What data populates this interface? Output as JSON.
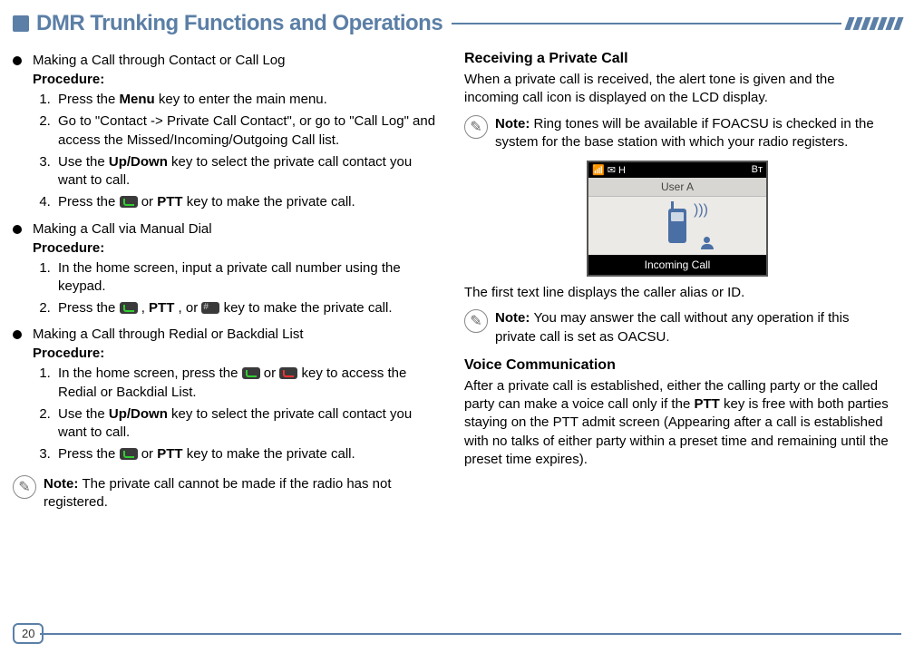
{
  "header": {
    "title": "DMR Trunking Functions and Operations"
  },
  "left": {
    "b1": {
      "title": "Making a Call through Contact or Call Log",
      "proc": "Procedure:",
      "s1a": "Press the ",
      "s1b": "Menu",
      "s1c": " key to enter the main menu.",
      "s2": "Go to \"Contact -> Private Call Contact\", or go to \"Call Log\" and access the Missed/Incoming/Outgoing Call list.",
      "s3a": "Use the ",
      "s3b": "Up/Down",
      "s3c": " key to select the private call contact you want to call.",
      "s4a": "Press the ",
      "s4b": " or ",
      "s4c": "PTT",
      "s4d": " key to make the private call."
    },
    "b2": {
      "title": "Making a Call via Manual Dial",
      "proc": "Procedure:",
      "s1": "In the home screen, input a private call number using the keypad.",
      "s2a": "Press the ",
      "s2b": " , ",
      "s2c": "PTT",
      "s2d": " , or ",
      "s2e": " key to make the private call."
    },
    "b3": {
      "title": "Making a Call through Redial or Backdial List",
      "proc": "Procedure:",
      "s1a": "In the home screen, press the ",
      "s1b": " or ",
      "s1c": " key to access the Redial or Backdial List.",
      "s2a": "Use the ",
      "s2b": "Up/Down",
      "s2c": " key to select the private call contact you want to call.",
      "s3a": "Press the ",
      "s3b": " or  ",
      "s3c": "PTT",
      "s3d": " key to make the private call."
    },
    "note1": {
      "label": "Note: ",
      "text": "The private call cannot be made if the radio has not registered."
    }
  },
  "right": {
    "h1": "Receiving a Private Call",
    "p1": "When a private call is received, the alert tone is given and the incoming call icon is displayed on the LCD display.",
    "note1": {
      "label": "Note: ",
      "text": "Ring tones will be available if FOACSU is checked in the system for the base station with which your radio registers."
    },
    "lcd": {
      "status_left": "📶 ✉ H",
      "status_right": "Bᴛ",
      "user": "User A",
      "footer": "Incoming Call"
    },
    "p2": "The first text line displays the caller alias or ID.",
    "note2": {
      "label": "Note: ",
      "text": "You may answer the call without any operation if this private call is set as OACSU."
    },
    "h2": "Voice Communication",
    "p3a": "After a private call is established, either the calling party or the called party can make a voice call only if the ",
    "p3b": "PTT",
    "p3c": " key is free with both parties staying on the PTT admit screen (Appearing after a call is established with no talks of either party within a preset time and remaining until the preset time expires)."
  },
  "page": "20"
}
